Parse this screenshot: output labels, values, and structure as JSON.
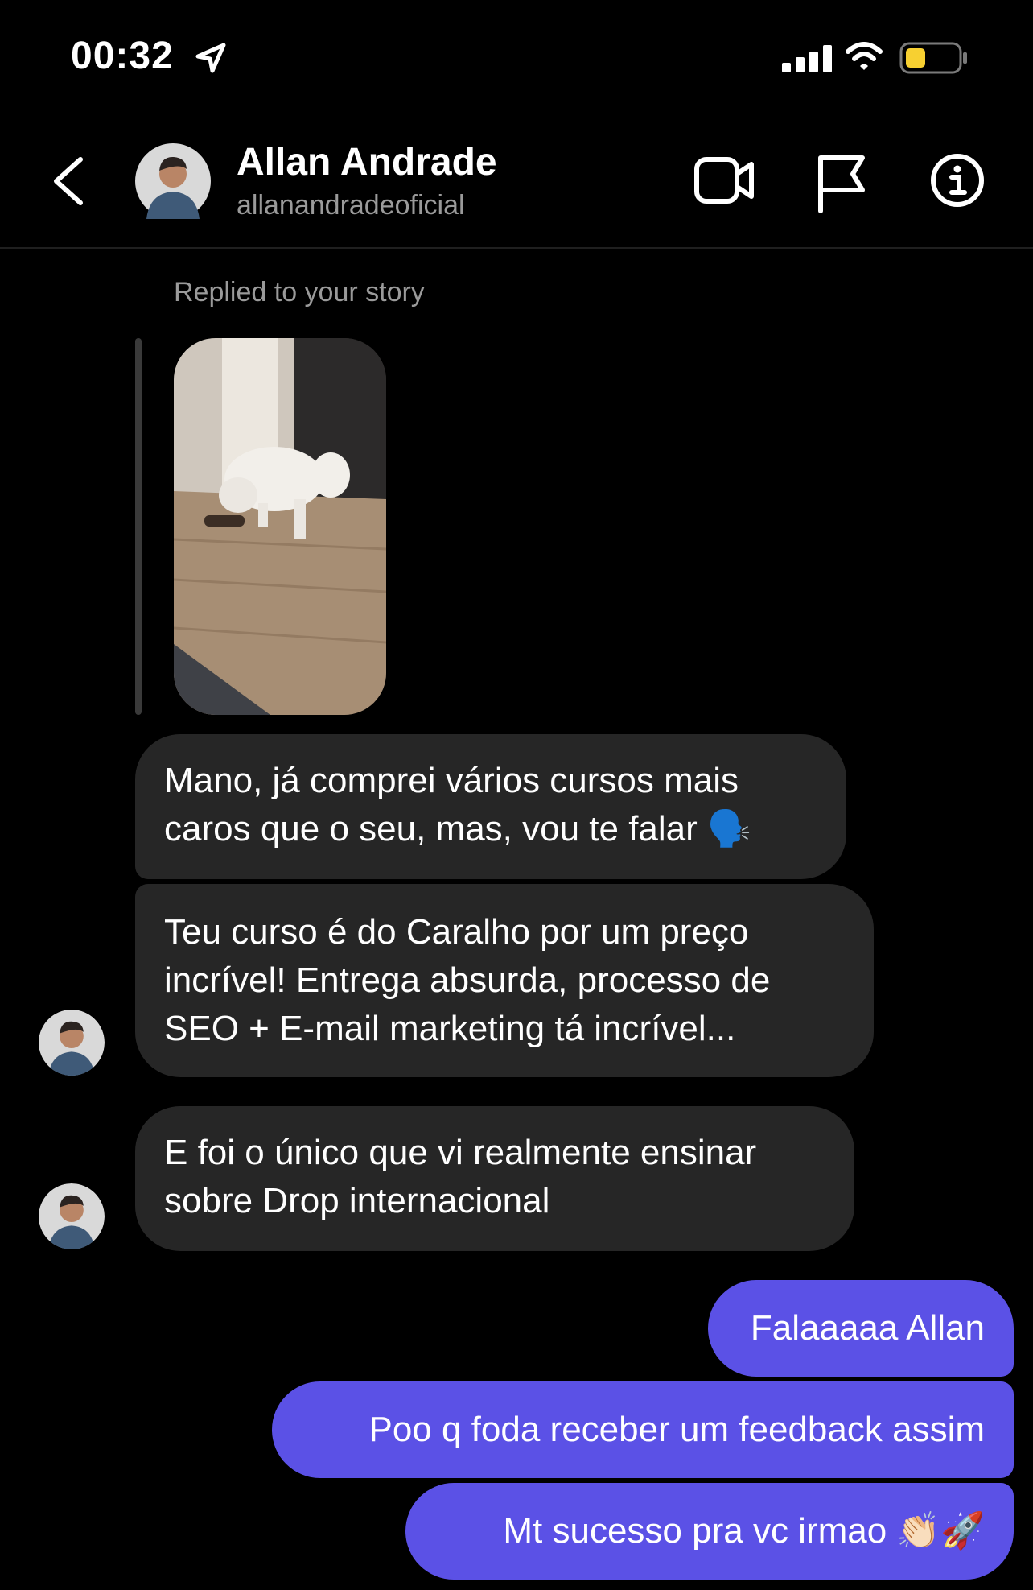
{
  "status_bar": {
    "time": "00:32",
    "battery_color": "#f7d031"
  },
  "header": {
    "contact_name": "Allan Andrade",
    "contact_handle": "allanandradeoficial",
    "icons": [
      "back-chevron-icon",
      "video-call-icon",
      "flag-icon",
      "info-icon"
    ]
  },
  "story_reply": {
    "label": "Replied to your story"
  },
  "messages": [
    {
      "from": "contact",
      "text": "Mano, já comprei vários cursos mais\ncaros que o seu, mas, vou te falar 🗣️"
    },
    {
      "from": "contact",
      "text": "Teu curso é do Caralho por um preço\nincrível! Entrega absurda, processo de\nSEO + E-mail marketing tá incrível..."
    },
    {
      "from": "contact",
      "text": "E foi o único que vi realmente ensinar\nsobre Drop internacional"
    },
    {
      "from": "me",
      "text": "Falaaaaa Allan"
    },
    {
      "from": "me",
      "text": "Poo q foda receber um feedback assim"
    },
    {
      "from": "me",
      "text": "Mt sucesso pra vc irmao 👏🏻🚀"
    }
  ],
  "colors": {
    "background": "#000000",
    "incoming_bubble": "#262626",
    "outgoing_bubble": "#5b51e6",
    "secondary_text": "#9a9a9a"
  }
}
